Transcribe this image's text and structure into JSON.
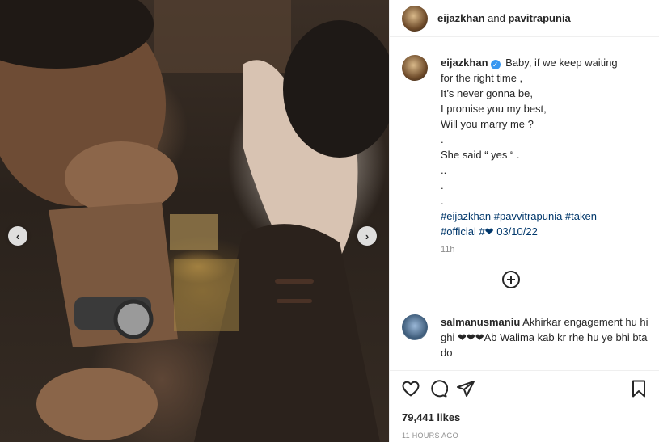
{
  "post": {
    "header": {
      "author": "eijazkhan",
      "connector": "and",
      "coauthor": "pavitrapunia_"
    },
    "caption": {
      "author": "eijazkhan",
      "verified_icon": "verified-badge-icon",
      "lines": [
        "Baby, if we keep waiting",
        "for the right time ,",
        "It’s never gonna be,",
        "I promise you my best,",
        "Will you marry me ?",
        ".",
        "She said “ yes “ .",
        "..",
        ".",
        "."
      ],
      "hashtags_line1": "#eijazkhan #pavvitrapunia #taken",
      "hashtags_line2": "#official #❤ 03/10/22",
      "time": "11h"
    },
    "load_more_icon": "plus-circle-icon",
    "comment": {
      "author": "salmanusmaniu",
      "text": "Akhirkar engagement hu hi ghi ❤❤❤Ab Walima kab kr rhe hu ye bhi bta do"
    },
    "actions": {
      "like_icon": "heart-icon",
      "comment_icon": "comment-icon",
      "share_icon": "paper-plane-icon",
      "save_icon": "bookmark-icon",
      "likes": "79,441 likes",
      "posted_ago": "11 HOURS AGO"
    },
    "carousel": {
      "prev_icon": "chevron-left-icon",
      "prev_glyph": "‹",
      "next_icon": "chevron-right-icon",
      "next_glyph": "›"
    },
    "colors": {
      "hashtag": "#00376b",
      "verified": "#3897f0",
      "muted": "#8e8e8e"
    }
  }
}
